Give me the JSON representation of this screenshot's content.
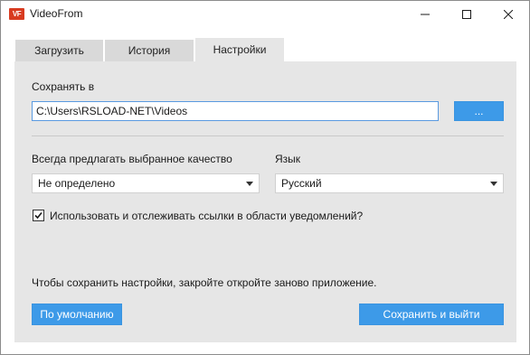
{
  "window": {
    "title": "VideoFrom",
    "icon_text": "VF"
  },
  "tabs": [
    {
      "label": "Загрузить",
      "active": false
    },
    {
      "label": "История",
      "active": false
    },
    {
      "label": "Настройки",
      "active": true
    }
  ],
  "settings": {
    "save_to_label": "Сохранять в",
    "save_path": "C:\\Users\\RSLOAD-NET\\Videos",
    "browse_label": "...",
    "quality_label": "Всегда предлагать выбранное качество",
    "quality_value": "Не определено",
    "language_label": "Язык",
    "language_value": "Русский",
    "monitor_links_label": "Использовать и отслеживать ссылки в области уведомлений?",
    "monitor_links_checked": true,
    "note": "Чтобы сохранить настройки, закройте  откройте заново приложение.",
    "default_button": "По умолчанию",
    "save_exit_button": "Сохранить и выйти"
  },
  "colors": {
    "accent": "#3d9ae8",
    "panel_bg": "#e6e6e6",
    "tab_bg": "#d9d9d9",
    "app_icon": "#d83b20"
  },
  "icons": {
    "app": "videofrom-logo-icon",
    "minimize": "minimize-icon",
    "maximize": "maximize-icon",
    "close": "close-icon",
    "dropdown": "chevron-down-icon",
    "check": "checkmark-icon"
  }
}
